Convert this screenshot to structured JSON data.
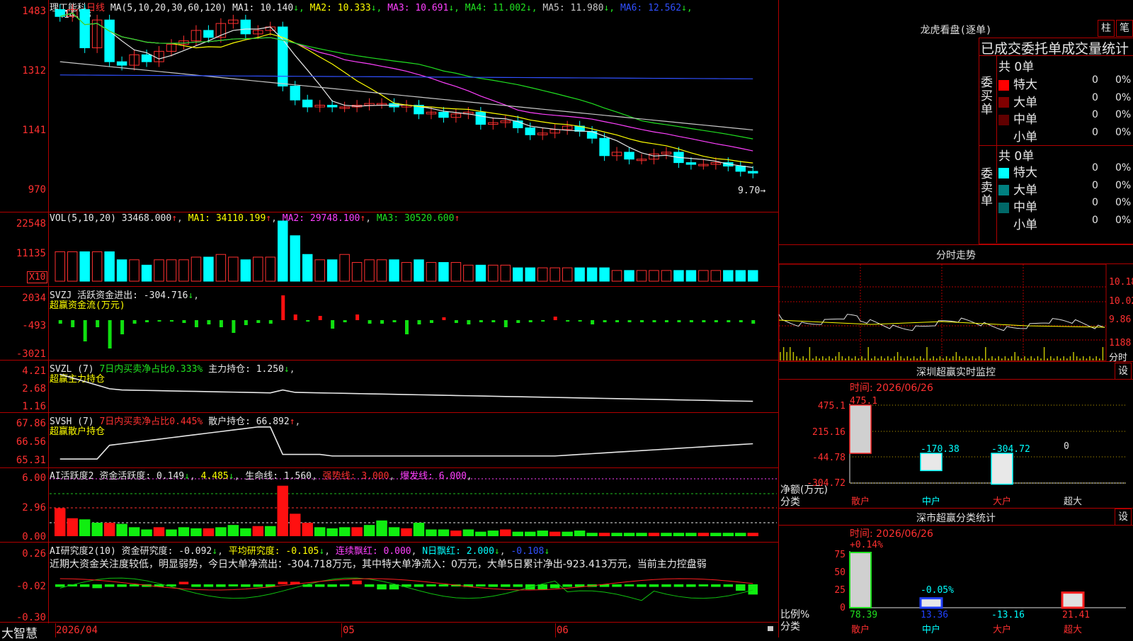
{
  "stock": {
    "name": "理工能科",
    "period": "日线",
    "ma_params": "MA(5,10,20,30,60,120)",
    "ma_values": [
      {
        "label": "MA1:",
        "value": "10.140",
        "arrow": "↓",
        "color": "#e8e8e8"
      },
      {
        "label": "MA2:",
        "value": "10.333",
        "arrow": "↓",
        "color": "#ffff00"
      },
      {
        "label": "MA3:",
        "value": "10.691",
        "arrow": "↓",
        "color": "#ff40ff"
      },
      {
        "label": "MA4:",
        "value": "11.002",
        "arrow": "↓",
        "color": "#20e020"
      },
      {
        "label": "MA5:",
        "value": "11.980",
        "arrow": "↓",
        "color": "#c8c8c8"
      },
      {
        "label": "MA6:",
        "value": "12.562",
        "arrow": "↓",
        "color": "#3050ff"
      }
    ],
    "high_label": "14.83",
    "low_label": "9.70"
  },
  "price_axis": [
    "1483",
    "1312",
    "1141",
    "970"
  ],
  "vol": {
    "header": "VOL(5,10,20)",
    "value": "33468.000",
    "ma1": "34110.199",
    "ma2": "29748.100",
    "ma3": "30520.600",
    "axis": [
      "22548",
      "11135"
    ],
    "unit": "X10"
  },
  "svzj": {
    "header": "SVZJ",
    "label": "活跃资金进出:",
    "value": "-304.716",
    "subtitle": "超赢资金流(万元)",
    "axis": [
      "2034",
      "-493",
      "-3021"
    ]
  },
  "svzl": {
    "header": "SVZL (7)",
    "label1": "7日内买卖净占比0.333%",
    "label2": "主力持仓:",
    "value": "1.250",
    "subtitle": "超赢主力持仓",
    "axis": [
      "4.21",
      "2.68",
      "1.16"
    ]
  },
  "svsh": {
    "header": "SVSH (7)",
    "label1": "7日内买卖净占比0.445%",
    "label2": "散户持仓:",
    "value": "66.892",
    "subtitle": "超赢散户持仓",
    "axis": [
      "67.86",
      "66.56",
      "65.31"
    ]
  },
  "ai_active": {
    "header": "AI活跃度2",
    "label1": "资金活跃度:",
    "value1": "0.149",
    "value2": "4.485",
    "label3": "生命线:",
    "value3": "1.560",
    "label4": "强势线:",
    "value4": "3.000",
    "label5": "爆发线:",
    "value5": "6.000",
    "axis": [
      "6.00",
      "2.96",
      "0.00"
    ]
  },
  "ai_research": {
    "header": "AI研究度2(10)",
    "label1": "资金研究度:",
    "value1": "-0.092",
    "label2": "平均研究度:",
    "value2": "-0.105",
    "label3": "连续飘红:",
    "value3": "0.000",
    "label4": "N日飘红:",
    "value4": "2.000",
    "value5": "-0.108",
    "comment": "近期大资金关注度较低，明显弱势，今日大单净流出：-304.718万元，其中特大单净流入：0万元，大单5日累计净出-923.413万元，当前主力控盘弱",
    "axis": [
      "0.26",
      "-0.02",
      "-0.30"
    ]
  },
  "time_axis": {
    "brand": "大智慧",
    "d1": "2026/04",
    "d2": "05",
    "d3": "06"
  },
  "dragon": {
    "title": "龙虎看盘(逐单)",
    "btn1": "柱",
    "btn2": "笔",
    "subtitle": "已成交委托单成交量统计",
    "buy": {
      "side": "委买单",
      "total": "共 0单",
      "rows": [
        {
          "label": "特大",
          "count": "0",
          "pct": "0%",
          "color": "#ff0000"
        },
        {
          "label": "大单",
          "count": "0",
          "pct": "0%",
          "color": "#800000"
        },
        {
          "label": "中单",
          "count": "0",
          "pct": "0%",
          "color": "#600000"
        },
        {
          "label": "小单",
          "count": "0",
          "pct": "0%",
          "color": "#000000"
        }
      ]
    },
    "sell": {
      "side": "委卖单",
      "total": "共 0单",
      "rows": [
        {
          "label": "特大",
          "count": "0",
          "pct": "0%",
          "color": "#00ffff"
        },
        {
          "label": "大单",
          "count": "0",
          "pct": "0%",
          "color": "#008080"
        },
        {
          "label": "中单",
          "count": "0",
          "pct": "0%",
          "color": "#006868"
        },
        {
          "label": "小单",
          "count": "0",
          "pct": "0%",
          "color": "#000000"
        }
      ]
    }
  },
  "intraday": {
    "title": "分时走势",
    "axis": [
      "10.18",
      "10.02",
      "9.86",
      "1188",
      "分时"
    ]
  },
  "monitor": {
    "title": "深圳超赢实时监控",
    "btn": "设",
    "date": "时间: 2026/06/26",
    "ylabel": "净额(万元)",
    "xlabel": "分类",
    "axis": [
      "475.1",
      "215.16",
      "-44.78",
      "-304.72"
    ],
    "categories": [
      "散户",
      "中户",
      "大户",
      "超大"
    ],
    "values": [
      "475.1",
      "-170.38",
      "-304.72",
      "0"
    ]
  },
  "classify": {
    "title": "深市超赢分类统计",
    "btn": "设",
    "date": "时间: 2026/06/26",
    "ylabel": "比例%",
    "xlabel": "分类",
    "top_label": "+0.14%",
    "mid_label": "-0.05%",
    "axis": [
      "75",
      "50",
      "25",
      "0"
    ],
    "categories": [
      "散户",
      "中户",
      "大户",
      "超大"
    ],
    "values": [
      "78.39",
      "13.36",
      "-13.16",
      "21.41"
    ]
  }
}
